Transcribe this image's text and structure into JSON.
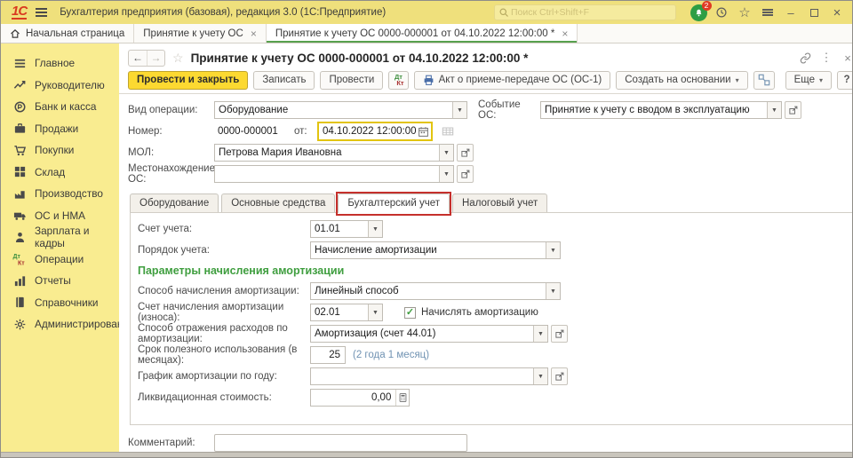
{
  "window": {
    "logo": "1С",
    "title": "Бухгалтерия предприятия (базовая), редакция 3.0  (1С:Предприятие)",
    "search_placeholder": "Поиск Ctrl+Shift+F",
    "notification_count": "2"
  },
  "tabs": [
    "Начальная страница",
    "Принятие к учету ОС",
    "Принятие к учету ОС 0000-000001 от 04.10.2022 12:00:00 *"
  ],
  "sidebar": {
    "items": [
      "Главное",
      "Руководителю",
      "Банк и касса",
      "Продажи",
      "Покупки",
      "Склад",
      "Производство",
      "ОС и НМА",
      "Зарплата и кадры",
      "Операции",
      "Отчеты",
      "Справочники",
      "Администрирование"
    ]
  },
  "form": {
    "title": "Принятие к учету ОС 0000-000001 от 04.10.2022 12:00:00 *",
    "toolbar": {
      "post_close": "Провести и закрыть",
      "save": "Записать",
      "post": "Провести",
      "dt": "Дт",
      "kt": "Кт",
      "act": "Акт о приеме-передаче ОС (ОС-1)",
      "create_based": "Создать на основании",
      "more": "Еще",
      "help": "?"
    },
    "fields": {
      "operation_label": "Вид операции:",
      "operation_value": "Оборудование",
      "event_label": "Событие ОС:",
      "event_value": "Принятие к учету с вводом в эксплуатацию",
      "number_label": "Номер:",
      "number_value": "0000-000001",
      "date_label": "от:",
      "date_value": "04.10.2022 12:00:00",
      "mol_label": "МОЛ:",
      "mol_value": "Петрова Мария Ивановна",
      "location_label": "Местонахождение ОС:",
      "location_value": ""
    },
    "doc_tabs": [
      "Оборудование",
      "Основные средства",
      "Бухгалтерский учет",
      "Налоговый учет"
    ],
    "accounting": {
      "account_label": "Счет учета:",
      "account_value": "01.01",
      "order_label": "Порядок учета:",
      "order_value": "Начисление амортизации",
      "section_title": "Параметры начисления амортизации",
      "method_label": "Способ начисления амортизации:",
      "method_value": "Линейный способ",
      "depr_account_label": "Счет начисления амортизации (износа):",
      "depr_account_value": "02.01",
      "accrue_label": "Начислять амортизацию",
      "expense_label": "Способ отражения расходов по амортизации:",
      "expense_value": "Амортизация (счет 44.01)",
      "term_label": "Срок полезного использования (в месяцах):",
      "term_value": "25",
      "term_hint": "(2 года 1 месяц)",
      "schedule_label": "График амортизации по году:",
      "schedule_value": "",
      "liquidation_label": "Ликвидационная стоимость:",
      "liquidation_value": "0,00"
    },
    "comment_label": "Комментарий:"
  },
  "colors": {
    "titlebar_yellow": "#efe07c",
    "sidebar_yellow": "#f9ec90",
    "accent_button_yellow": "#fcd931",
    "active_tab_green": "#58a14e",
    "section_green": "#3f9e3f",
    "annotation_red": "#c5302c",
    "hint_blue": "#7193b3",
    "focus_border_yellow": "#e2c40f"
  },
  "icons": {
    "search": "magnifier",
    "notifications": "bell-with-red-badge",
    "history": "clock",
    "favorites": "star",
    "service_menu": "bars",
    "minimize": "dash",
    "maximize": "square",
    "close": "cross",
    "home": "house",
    "print": "printer",
    "dropdown": "triangle-down",
    "open_link": "square-with-arrow",
    "calendar": "calendar-grid",
    "calculator": "calculator",
    "link": "chain",
    "more": "vertical-dots",
    "dtkt": "debit-credit-letters"
  }
}
